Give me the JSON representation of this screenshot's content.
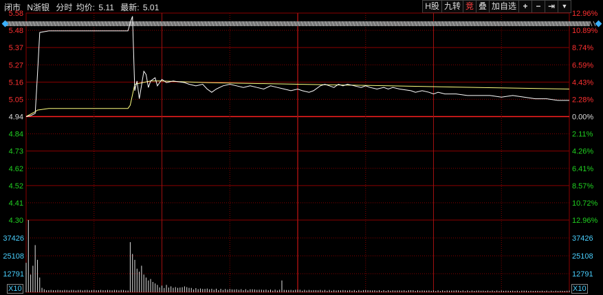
{
  "header": {
    "status": "闭市",
    "stock_name": "N浙银",
    "mode": "分时",
    "avg_label": "均价:",
    "avg_value": "5.11",
    "latest_label": "最新:",
    "latest_value": "5.01"
  },
  "toolbar": {
    "h_share": "H股",
    "nine_turn": "九转",
    "auction": "竞",
    "overlay": "叠",
    "add_watch": "加自选",
    "plus_icon": "plus-icon",
    "minus_icon": "minus-icon",
    "arrow_icon": "arrow-right-icon",
    "menu_icon": "chevron-down-icon"
  },
  "colors": {
    "up": "#ff3030",
    "down": "#20d020",
    "price_line": "#ffffff",
    "avg_line": "#ffff80",
    "grid": "#8b0000",
    "volume": "#e0e0e0",
    "vol_label": "#4ad0ff"
  },
  "chart_data": {
    "type": "line",
    "price_ticks": [
      "5.58",
      "5.48",
      "5.37",
      "5.27",
      "5.16",
      "5.05",
      "4.94",
      "4.84",
      "4.73",
      "4.62",
      "4.52",
      "4.41",
      "4.30"
    ],
    "pct_ticks": [
      "12.96%",
      "10.89%",
      "8.74%",
      "6.59%",
      "4.43%",
      "2.28%",
      "0.00%",
      "2.11%",
      "4.26%",
      "6.41%",
      "8.57%",
      "10.72%",
      "12.96%"
    ],
    "pct_ticks_up_count": 6,
    "base_price": 4.94,
    "ylim": [
      4.3,
      5.58
    ],
    "volume_ticks": [
      "37426",
      "25108",
      "12791"
    ],
    "volume_unit": "X10",
    "volume_max": 49000,
    "price_series": [
      [
        0,
        4.94
      ],
      [
        2,
        4.945
      ],
      [
        4,
        4.96
      ],
      [
        5,
        5.2
      ],
      [
        6,
        5.46
      ],
      [
        10,
        5.47
      ],
      [
        30,
        5.47
      ],
      [
        45,
        5.47
      ],
      [
        46,
        5.52
      ],
      [
        47,
        5.56
      ],
      [
        48,
        5.1
      ],
      [
        49,
        5.16
      ],
      [
        50,
        5.05
      ],
      [
        52,
        5.22
      ],
      [
        53,
        5.2
      ],
      [
        54,
        5.12
      ],
      [
        55,
        5.16
      ],
      [
        57,
        5.18
      ],
      [
        58,
        5.13
      ],
      [
        60,
        5.17
      ],
      [
        62,
        5.15
      ],
      [
        65,
        5.16
      ],
      [
        70,
        5.15
      ],
      [
        72,
        5.14
      ],
      [
        75,
        5.13
      ],
      [
        78,
        5.14
      ],
      [
        80,
        5.11
      ],
      [
        82,
        5.09
      ],
      [
        84,
        5.11
      ],
      [
        87,
        5.13
      ],
      [
        90,
        5.14
      ],
      [
        93,
        5.13
      ],
      [
        96,
        5.12
      ],
      [
        99,
        5.13
      ],
      [
        102,
        5.12
      ],
      [
        105,
        5.11
      ],
      [
        108,
        5.13
      ],
      [
        111,
        5.12
      ],
      [
        114,
        5.11
      ],
      [
        117,
        5.1
      ],
      [
        120,
        5.11
      ],
      [
        122,
        5.1
      ],
      [
        125,
        5.09
      ],
      [
        127,
        5.1
      ],
      [
        130,
        5.13
      ],
      [
        132,
        5.14
      ],
      [
        134,
        5.13
      ],
      [
        136,
        5.12
      ],
      [
        138,
        5.14
      ],
      [
        140,
        5.13
      ],
      [
        142,
        5.14
      ],
      [
        145,
        5.13
      ],
      [
        148,
        5.12
      ],
      [
        150,
        5.13
      ],
      [
        152,
        5.12
      ],
      [
        155,
        5.11
      ],
      [
        158,
        5.12
      ],
      [
        160,
        5.11
      ],
      [
        162,
        5.12
      ],
      [
        165,
        5.11
      ],
      [
        170,
        5.1
      ],
      [
        172,
        5.09
      ],
      [
        175,
        5.1
      ],
      [
        178,
        5.09
      ],
      [
        180,
        5.08
      ],
      [
        182,
        5.09
      ],
      [
        185,
        5.08
      ],
      [
        190,
        5.08
      ],
      [
        195,
        5.07
      ],
      [
        200,
        5.07
      ],
      [
        205,
        5.07
      ],
      [
        210,
        5.06
      ],
      [
        215,
        5.07
      ],
      [
        220,
        5.06
      ],
      [
        225,
        5.05
      ],
      [
        230,
        5.05
      ],
      [
        235,
        5.04
      ],
      [
        240,
        5.04
      ]
    ],
    "avg_series": [
      [
        0,
        4.94
      ],
      [
        2,
        4.955
      ],
      [
        4,
        4.97
      ],
      [
        5,
        4.98
      ],
      [
        10,
        4.99
      ],
      [
        45,
        4.99
      ],
      [
        46,
        5.01
      ],
      [
        48,
        5.14
      ],
      [
        55,
        5.16
      ],
      [
        60,
        5.16
      ],
      [
        80,
        5.15
      ],
      [
        120,
        5.14
      ],
      [
        160,
        5.13
      ],
      [
        200,
        5.12
      ],
      [
        240,
        5.11
      ]
    ],
    "volume": [
      [
        0,
        20000
      ],
      [
        1,
        49000
      ],
      [
        2,
        12000
      ],
      [
        3,
        18000
      ],
      [
        4,
        32000
      ],
      [
        5,
        22000
      ],
      [
        6,
        10000
      ],
      [
        7,
        3000
      ],
      [
        8,
        2000
      ],
      [
        30,
        1500
      ],
      [
        40,
        1500
      ],
      [
        45,
        1200
      ],
      [
        46,
        34000
      ],
      [
        47,
        26000
      ],
      [
        48,
        22000
      ],
      [
        49,
        16000
      ],
      [
        50,
        14000
      ],
      [
        51,
        18000
      ],
      [
        52,
        12000
      ],
      [
        53,
        10000
      ],
      [
        54,
        8000
      ],
      [
        55,
        9000
      ],
      [
        56,
        7000
      ],
      [
        57,
        6000
      ],
      [
        58,
        5000
      ],
      [
        60,
        4500
      ],
      [
        62,
        5000
      ],
      [
        64,
        4000
      ],
      [
        66,
        3500
      ],
      [
        68,
        3200
      ],
      [
        70,
        4000
      ],
      [
        72,
        3000
      ],
      [
        75,
        2800
      ],
      [
        80,
        2500
      ],
      [
        90,
        2200
      ],
      [
        100,
        2000
      ],
      [
        110,
        1800
      ],
      [
        120,
        1700
      ],
      [
        130,
        1600
      ],
      [
        140,
        1500
      ],
      [
        150,
        1500
      ],
      [
        160,
        1400
      ],
      [
        170,
        1400
      ],
      [
        180,
        1300
      ],
      [
        190,
        1300
      ],
      [
        200,
        1200
      ],
      [
        210,
        1200
      ],
      [
        220,
        1100
      ],
      [
        230,
        1100
      ],
      [
        240,
        1100
      ]
    ],
    "volume_spikes": [
      [
        113,
        8000
      ]
    ]
  }
}
